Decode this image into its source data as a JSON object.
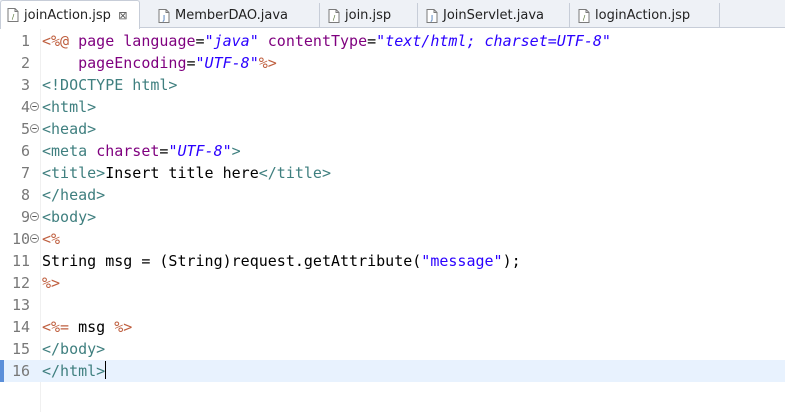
{
  "tabs": [
    {
      "label": "joinAction.jsp",
      "icon": "jsp-file-icon",
      "active": true,
      "close": "⊠"
    },
    {
      "label": "MemberDAO.java",
      "icon": "java-file-icon",
      "active": false
    },
    {
      "label": "join.jsp",
      "icon": "jsp-file-icon",
      "active": false
    },
    {
      "label": "JoinServlet.java",
      "icon": "java-file-icon",
      "active": false
    },
    {
      "label": "loginAction.jsp",
      "icon": "jsp-file-icon",
      "active": false
    }
  ],
  "editor": {
    "current_line": 16,
    "lines": [
      {
        "n": "1",
        "fold": false,
        "tokens": [
          [
            "jsp",
            "<%@ "
          ],
          [
            "attr",
            "page "
          ],
          [
            "attr",
            "language"
          ],
          [
            "txt",
            "="
          ],
          [
            "val",
            "\"java\""
          ],
          [
            "txt",
            " "
          ],
          [
            "attr",
            "contentType"
          ],
          [
            "txt",
            "="
          ],
          [
            "val",
            "\"text/html; charset=UTF-8\""
          ]
        ]
      },
      {
        "n": "2",
        "fold": false,
        "tokens": [
          [
            "txt",
            "    "
          ],
          [
            "attr",
            "pageEncoding"
          ],
          [
            "txt",
            "="
          ],
          [
            "val",
            "\"UTF-8\""
          ],
          [
            "jsp",
            "%>"
          ]
        ]
      },
      {
        "n": "3",
        "fold": false,
        "tokens": [
          [
            "tag",
            "<!DOCTYPE html>"
          ]
        ]
      },
      {
        "n": "4",
        "fold": true,
        "tokens": [
          [
            "tag",
            "<html>"
          ]
        ]
      },
      {
        "n": "5",
        "fold": true,
        "tokens": [
          [
            "tag",
            "<head>"
          ]
        ]
      },
      {
        "n": "6",
        "fold": false,
        "tokens": [
          [
            "tag",
            "<meta "
          ],
          [
            "attr",
            "charset"
          ],
          [
            "txt",
            "="
          ],
          [
            "val",
            "\"UTF-8\""
          ],
          [
            "tag",
            ">"
          ]
        ]
      },
      {
        "n": "7",
        "fold": false,
        "tokens": [
          [
            "tag",
            "<title>"
          ],
          [
            "txt",
            "Insert title here"
          ],
          [
            "tag",
            "</title>"
          ]
        ]
      },
      {
        "n": "8",
        "fold": false,
        "tokens": [
          [
            "tag",
            "</head>"
          ]
        ]
      },
      {
        "n": "9",
        "fold": true,
        "tokens": [
          [
            "tag",
            "<body>"
          ]
        ]
      },
      {
        "n": "10",
        "fold": true,
        "tokens": [
          [
            "jsp",
            "<%"
          ]
        ]
      },
      {
        "n": "11",
        "fold": false,
        "tokens": [
          [
            "txt",
            "String msg = (String)request.getAttribute("
          ],
          [
            "str",
            "\"message\""
          ],
          [
            "txt",
            ");"
          ]
        ]
      },
      {
        "n": "12",
        "fold": false,
        "tokens": [
          [
            "jsp",
            "%>"
          ]
        ]
      },
      {
        "n": "13",
        "fold": false,
        "tokens": []
      },
      {
        "n": "14",
        "fold": false,
        "tokens": [
          [
            "jsp",
            "<%= "
          ],
          [
            "txt",
            "msg "
          ],
          [
            "jsp",
            "%>"
          ]
        ]
      },
      {
        "n": "15",
        "fold": false,
        "tokens": [
          [
            "tag",
            "</body>"
          ]
        ]
      },
      {
        "n": "16",
        "fold": false,
        "tokens": [
          [
            "tag",
            "</html>"
          ]
        ]
      }
    ]
  }
}
